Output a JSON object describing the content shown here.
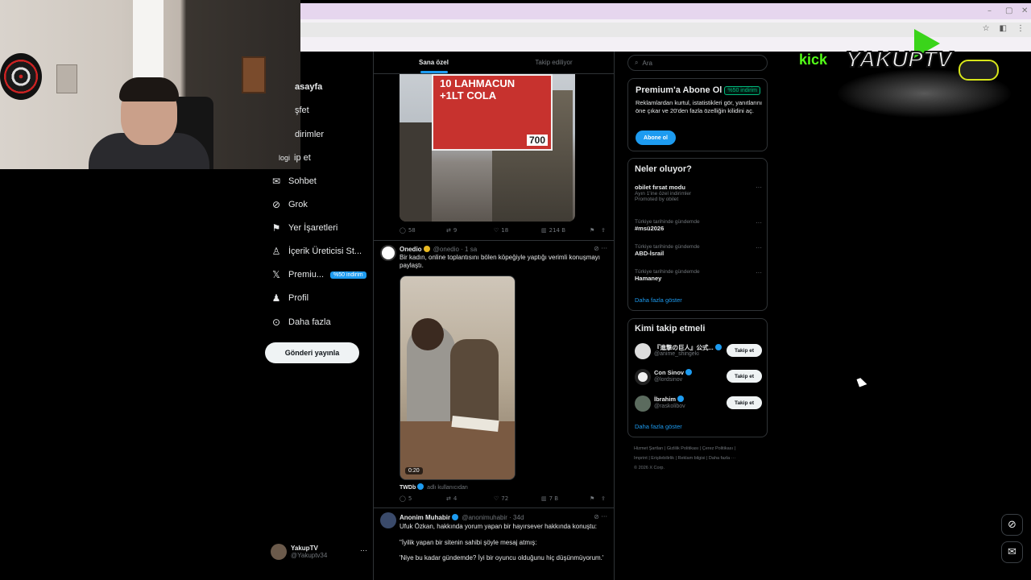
{
  "nav": {
    "items": [
      {
        "label": "asayfa",
        "icon": "home-icon"
      },
      {
        "label": "şfet",
        "icon": "search-icon"
      },
      {
        "label": "dirimler",
        "icon": "bell-icon"
      },
      {
        "label": "ip et",
        "icon": "follow-icon"
      },
      {
        "label": "Sohbet",
        "icon": "mail-icon"
      },
      {
        "label": "Grok",
        "icon": "grok-icon"
      },
      {
        "label": "Yer İşaretleri",
        "icon": "bookmark-icon"
      },
      {
        "label": "İçerik Üreticisi St...",
        "icon": "creator-studio-icon"
      },
      {
        "label": "Premiu...",
        "icon": "x-logo-icon",
        "badge": "%50 indirim"
      },
      {
        "label": "Profil",
        "icon": "person-icon"
      },
      {
        "label": "Daha fazla",
        "icon": "more-circle-icon"
      }
    ],
    "overlay_text": "logi",
    "post_button": "Gönderi yayınla"
  },
  "profile": {
    "name": "YakupTV",
    "handle": "@Yakuptv34",
    "more": "···"
  },
  "feed": {
    "tabs": [
      "Sana özel",
      "Takip ediliyor"
    ],
    "post1": {
      "sign_text": "10 LAHMACUN\n+1LT COLA",
      "sign_price": "700",
      "actions": {
        "reply": "58",
        "repost": "9",
        "like": "18",
        "views": "214 B"
      }
    },
    "post2": {
      "name": "Onedio",
      "handle": "@onedio · 1 sa",
      "text": "Bir kadın, online toplantısını bölen köpeğiyle yaptığı verimli konuşmayı paylaştı.",
      "video_time": "0:20",
      "credit_name": "TWDb",
      "credit_rest": "adlı kullanıcıdan",
      "actions": {
        "reply": "5",
        "repost": "4",
        "like": "72",
        "views": "7 B"
      }
    },
    "post3": {
      "name": "Anonim Muhabir",
      "handle": "@anonimuhabir · 34d",
      "line1": "Ufuk Özkan, hakkında yorum yapan bir hayırsever hakkında konuştu:",
      "line2": "\"İyilik yapan bir sitenin sahibi şöyle mesaj atmış:",
      "line3": "'Niye bu kadar gündemde? İyi bir oyuncu olduğunu hiç düşünmüyorum.'"
    }
  },
  "search": {
    "placeholder": "Ara"
  },
  "premium": {
    "title": "Premium'a Abone Ol",
    "badge": "%50 indirim",
    "description": "Reklamlardan kurtul, istatistikleri gör, yanıtlarını öne çıkar ve 20'den fazla özelliğin kilidini aç.",
    "button": "Abone ol"
  },
  "trends": {
    "title": "Neler oluyor?",
    "promoted": {
      "title": "obilet fırsat modu",
      "subtitle": "Ayın 1'ine özel indirimler",
      "promo": "Promoted by obilet"
    },
    "items": [
      {
        "context": "Türkiye tarihinde gündemde",
        "title": "#msü2026"
      },
      {
        "context": "Türkiye tarihinde gündemde",
        "title": "ABD-İsrail"
      },
      {
        "context": "Türkiye tarihinde gündemde",
        "title": "Hamaney"
      }
    ],
    "show_more": "Daha fazla göster"
  },
  "who_to_follow": {
    "title": "Kimi takip etmeli",
    "items": [
      {
        "name": "『進撃の巨人』公式...",
        "handle": "@anime_shingeki"
      },
      {
        "name": "Con Sinov",
        "handle": "@lordsinov"
      },
      {
        "name": "İbrahim",
        "handle": "@raskolibov"
      }
    ],
    "follow_label": "Takip et",
    "show_more": "Daha fazla göster"
  },
  "footer": {
    "line1": "Hizmet Şartları  |  Gizlilik Politikası  |  Çerez Politikası  |",
    "line2": "Imprint  |  Erişilebilirlik  |  Reklam bilgisi  |  Daha fazla ···",
    "line3": "© 2026 X Corp."
  },
  "overlay": {
    "kick": "kick",
    "logo": "YAKUPTV"
  },
  "colors": {
    "accent": "#1d9bf0",
    "background": "#000000",
    "kick_green": "#53fc18"
  }
}
